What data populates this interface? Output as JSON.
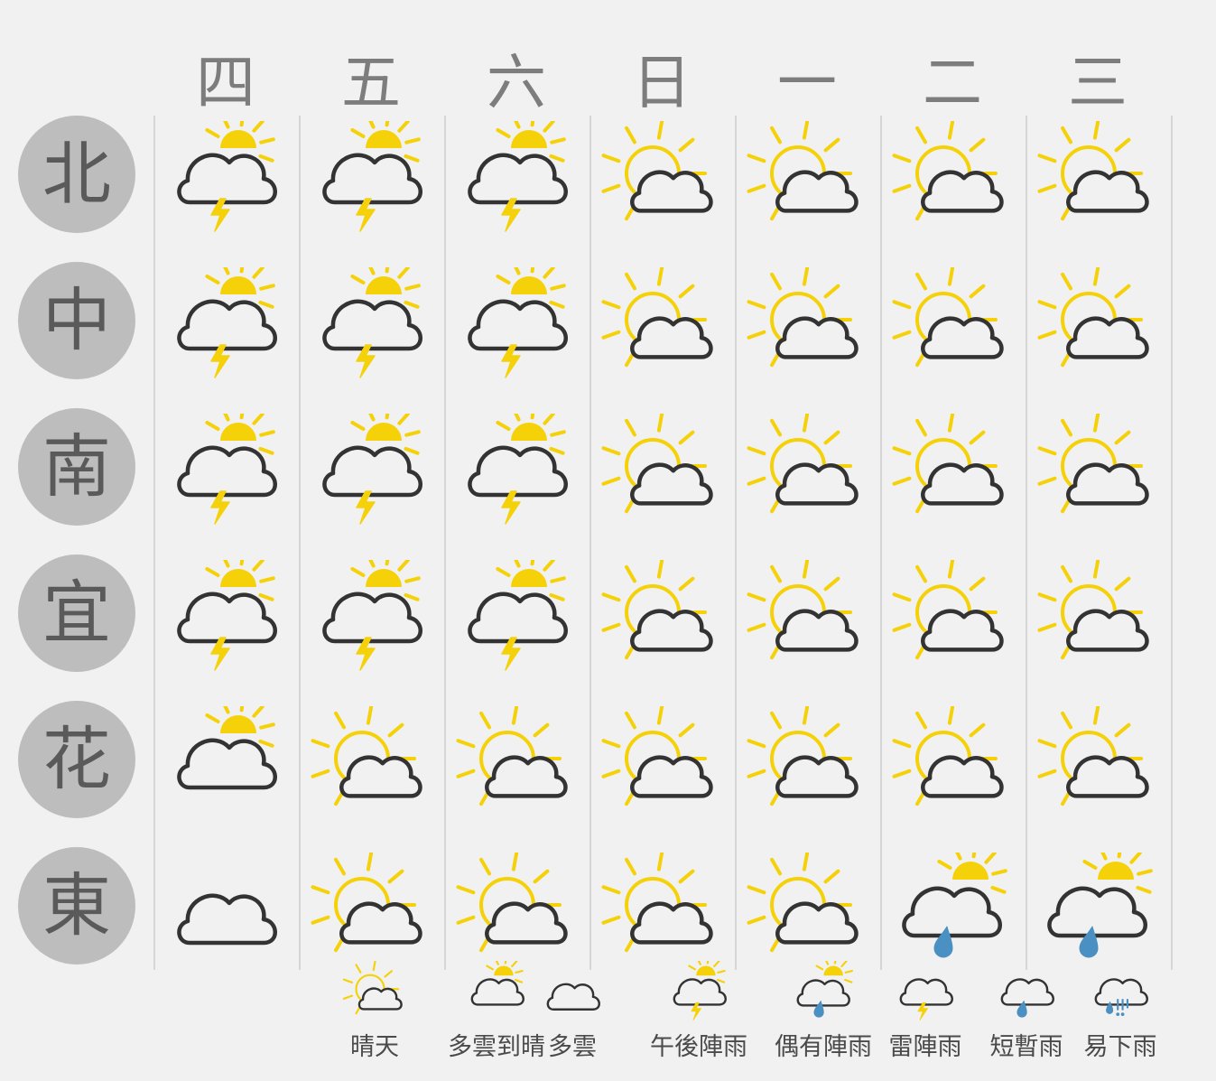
{
  "days": [
    {
      "label": "四"
    },
    {
      "label": "五"
    },
    {
      "label": "六"
    },
    {
      "label": "日"
    },
    {
      "label": "一"
    },
    {
      "label": "二"
    },
    {
      "label": "三"
    }
  ],
  "regions": [
    {
      "label": "北",
      "forecast": [
        "thunder-partly-sunny",
        "thunder-partly-sunny",
        "thunder-partly-sunny",
        "sunny",
        "sunny",
        "sunny",
        "sunny"
      ]
    },
    {
      "label": "中",
      "forecast": [
        "thunder-partly-sunny",
        "thunder-partly-sunny",
        "thunder-partly-sunny",
        "sunny",
        "sunny",
        "sunny",
        "sunny"
      ]
    },
    {
      "label": "南",
      "forecast": [
        "thunder-partly-sunny",
        "thunder-partly-sunny",
        "thunder-partly-sunny",
        "sunny",
        "sunny",
        "sunny",
        "sunny"
      ]
    },
    {
      "label": "宜",
      "forecast": [
        "thunder-partly-sunny",
        "thunder-partly-sunny",
        "thunder-partly-sunny",
        "sunny",
        "sunny",
        "sunny",
        "sunny"
      ]
    },
    {
      "label": "花",
      "forecast": [
        "partly-sunny",
        "sunny",
        "sunny",
        "sunny",
        "sunny",
        "sunny",
        "sunny"
      ]
    },
    {
      "label": "東",
      "forecast": [
        "cloudy",
        "sunny",
        "sunny",
        "sunny",
        "sunny",
        "rain-partly-sunny",
        "rain-partly-sunny"
      ]
    }
  ],
  "legend": [
    {
      "label": "晴天",
      "icon": "sunny"
    },
    {
      "label": "多雲到晴",
      "icon": "partly-sunny"
    },
    {
      "label": "多雲",
      "icon": "cloudy"
    },
    {
      "label": "午後陣雨",
      "icon": "thunder-partly-sunny"
    },
    {
      "label": "偶有陣雨",
      "icon": "rain-partly-sunny"
    },
    {
      "label": "雷陣雨",
      "icon": "thunder"
    },
    {
      "label": "短暫雨",
      "icon": "rain"
    },
    {
      "label": "易下雨",
      "icon": "heavy-rain"
    }
  ],
  "colors": {
    "sun": "#f5d10a",
    "cloud_stroke": "#333333",
    "rain": "#4a90c2",
    "badge": "#bdbdbd",
    "background": "#f1f1f1"
  }
}
